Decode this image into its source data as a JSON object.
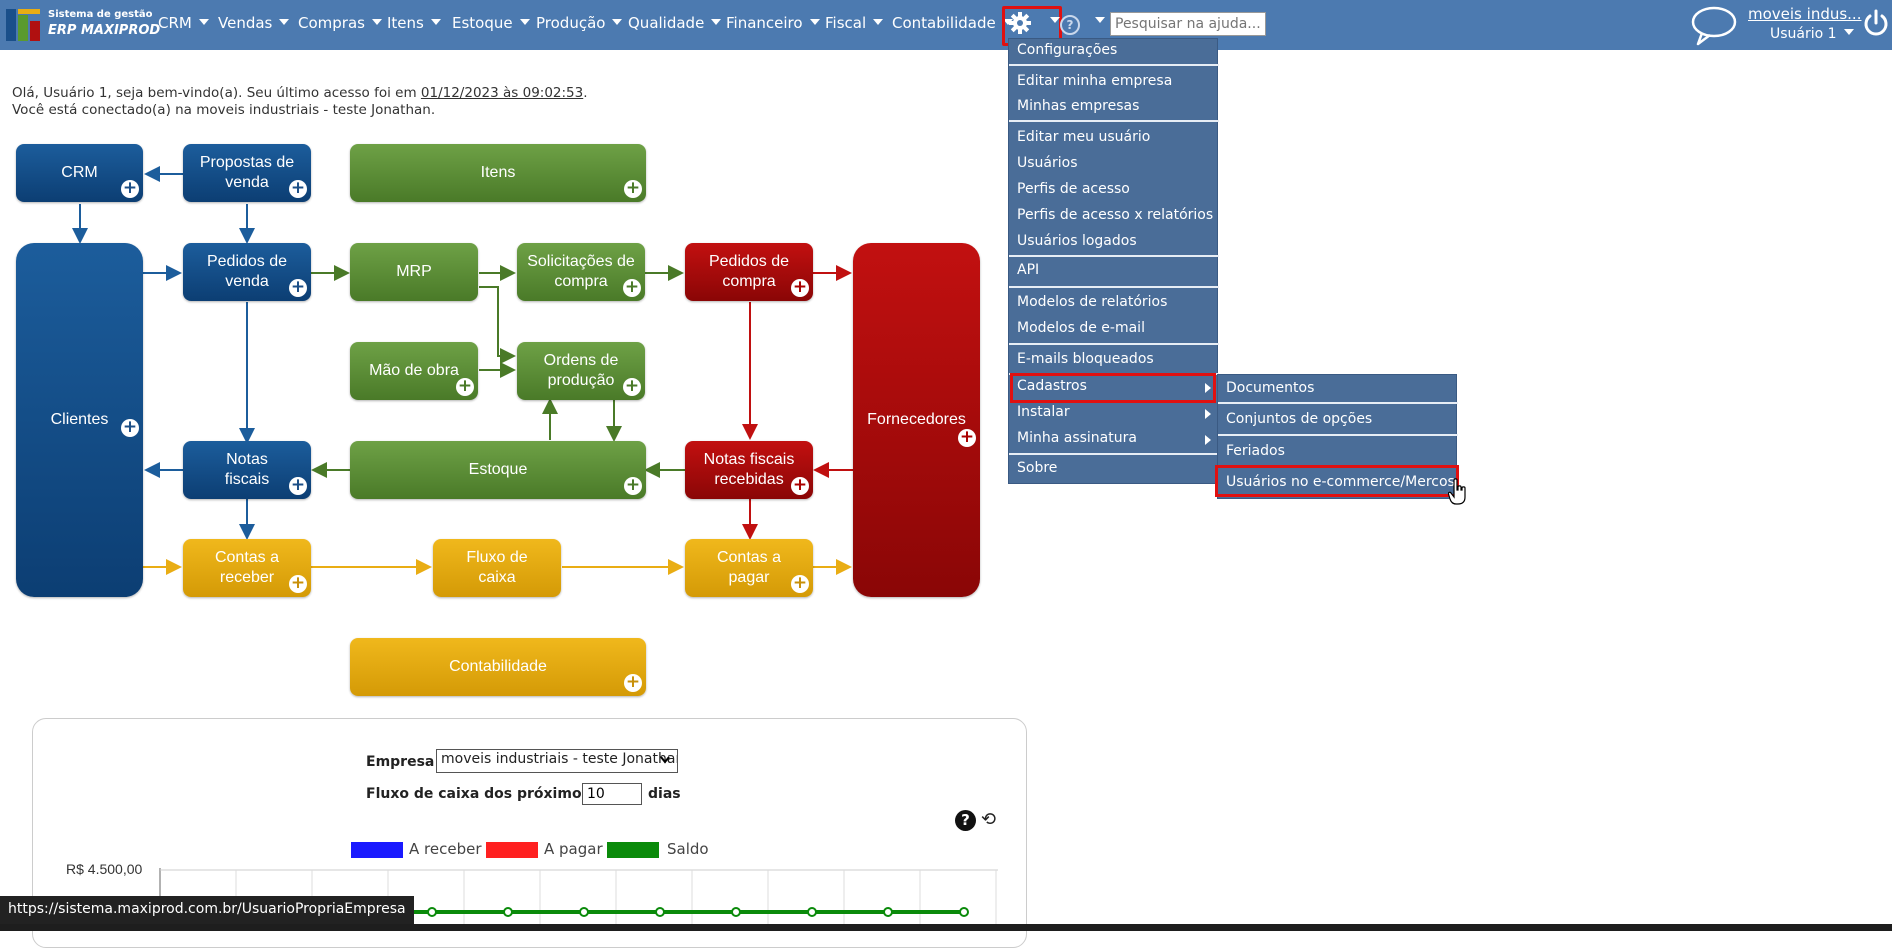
{
  "app": {
    "logo_line1": "Sistema de gestão",
    "logo_line2": "ERP MAXIPROD"
  },
  "menu": [
    {
      "label": "CRM"
    },
    {
      "label": "Vendas"
    },
    {
      "label": "Compras"
    },
    {
      "label": "Itens"
    },
    {
      "label": "Estoque"
    },
    {
      "label": "Produção"
    },
    {
      "label": "Qualidade"
    },
    {
      "label": "Financeiro"
    },
    {
      "label": "Fiscal"
    },
    {
      "label": "Contabilidade"
    }
  ],
  "search": {
    "placeholder": "Pesquisar na ajuda..."
  },
  "account": {
    "company": "moveis indus...",
    "user": "Usuário 1"
  },
  "welcome": {
    "line1_prefix": "Olá, Usuário 1, seja bem-vindo(a). Seu último acesso foi em",
    "last_access": "01/12/2023 às 09:02:53",
    "line1_suffix": ".",
    "line2": "Você está conectado(a) na moveis industriais - teste Jonathan."
  },
  "diagram": {
    "crm": "CRM",
    "propostas": "Propostas de venda",
    "itens": "Itens",
    "clientes": "Clientes",
    "pedidos_venda": "Pedidos de venda",
    "mrp": "MRP",
    "solicitacoes": "Solicitações de compra",
    "pedidos_compra": "Pedidos de compra",
    "fornecedores": "Fornecedores",
    "mao_obra": "Mão de obra",
    "ordens": "Ordens de produção",
    "notas_fiscais": "Notas fiscais",
    "estoque": "Estoque",
    "nf_recebidas": "Notas fiscais recebidas",
    "contas_receber": "Contas a receber",
    "fluxo_caixa": "Fluxo de caixa",
    "contas_pagar": "Contas a pagar",
    "contabilidade": "Contabilidade",
    "plus": "+"
  },
  "dashboard": {
    "empresa_label": "Empresa",
    "empresa_value": "moveis industriais - teste Jonathan",
    "fluxo_label": "Fluxo de caixa dos próximos",
    "fluxo_days": "10",
    "dias_label": "dias",
    "help_glyph": "?",
    "refresh_glyph": "⟲"
  },
  "chart_data": {
    "type": "line",
    "series": [
      {
        "name": "A receber",
        "color": "#1a1aff"
      },
      {
        "name": "A pagar",
        "color": "#ff2020"
      },
      {
        "name": "Saldo",
        "color": "#0a8a0a"
      }
    ],
    "y_top_label": "R$ 4.500,00",
    "saldo_points": 11
  },
  "status_url": "https://sistema.maxiprod.com.br/UsuarioPropriaEmpresa",
  "settings_menu": {
    "items": [
      "Configurações",
      "Editar minha empresa",
      "Minhas empresas",
      "Editar meu usuário",
      "Usuários",
      "Perfis de acesso",
      "Perfis de acesso x relatórios",
      "Usuários logados",
      "API",
      "Modelos de relatórios",
      "Modelos de e-mail",
      "E-mails bloqueados",
      "Cadastros",
      "Instalar",
      "Minha assinatura",
      "Sobre"
    ]
  },
  "cadastros_submenu": {
    "items": [
      "Documentos",
      "Conjuntos de opções",
      "Feriados",
      "Usuários no e-commerce/Mercos"
    ]
  },
  "colors": {
    "topbar": "#4c7ab0",
    "menu": "#4a6d98",
    "highlight": "#e01010"
  }
}
